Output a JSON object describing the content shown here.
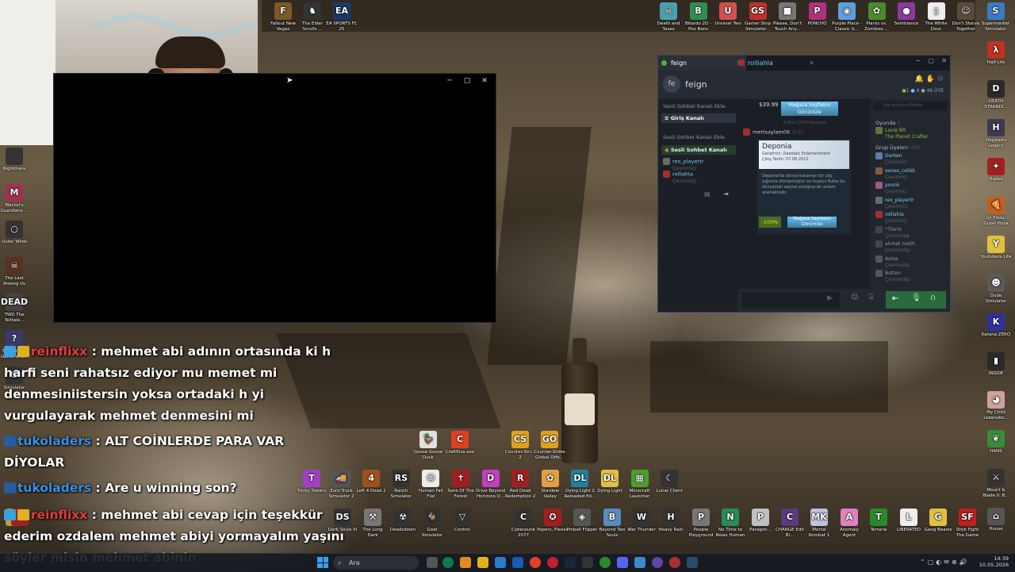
{
  "desktop_top_icons": [
    {
      "label": "Fallout New Vegas",
      "color": "#7a5a2a",
      "glyph": "F"
    },
    {
      "label": "The Elder Scrolls ...",
      "color": "#333",
      "glyph": "♞"
    },
    {
      "label": "EA SPORTS FC 25",
      "color": "#1a3a6a",
      "glyph": "EA"
    }
  ],
  "desktop_top_right": [
    {
      "label": "Death and Taxes",
      "color": "#4aa0b0",
      "glyph": "☠"
    },
    {
      "label": "Bitardo 2D - Poo Bans",
      "color": "#2f8f4f",
      "glyph": "B"
    },
    {
      "label": "Unravel Two",
      "color": "#d05050",
      "glyph": "U"
    },
    {
      "label": "Gamer Stop Simulator...",
      "color": "#c03030",
      "glyph": "GS"
    },
    {
      "label": "Please, Don't Touch Any...",
      "color": "#777",
      "glyph": "■"
    },
    {
      "label": "PONCHO",
      "color": "#b03080",
      "glyph": "P"
    },
    {
      "label": "Purple Place - Classic G...",
      "color": "#5aa0e0",
      "glyph": "◉"
    },
    {
      "label": "Plants vs. Zombies ...",
      "color": "#4a8a2a",
      "glyph": "✿"
    },
    {
      "label": "Semblance",
      "color": "#8a3aa0",
      "glyph": "●"
    },
    {
      "label": "The White Door",
      "color": "#eee",
      "glyph": "▯"
    },
    {
      "label": "Don't Starve Together",
      "color": "#5a4a3a",
      "glyph": "☺"
    },
    {
      "label": "Supermarket Simulator",
      "color": "#3a7ac0",
      "glyph": "S"
    }
  ],
  "desktop_right_column": [
    {
      "label": "Half-Life",
      "color": "#c03020",
      "glyph": "λ"
    },
    {
      "label": "DEATH STRANDI...",
      "color": "#2a2a2a",
      "glyph": "D"
    },
    {
      "label": "Hogwarts Legacy",
      "color": "#3a3a50",
      "glyph": "H"
    },
    {
      "label": "Hades",
      "color": "#a02020",
      "glyph": "✦"
    },
    {
      "label": "İyi Pizza, Güzel Pizza",
      "color": "#c06020",
      "glyph": "🍕"
    },
    {
      "label": "Youtubers Life",
      "color": "#e0c040",
      "glyph": "Y"
    },
    {
      "label": "Dude Simulator",
      "color": "#5a5a5a",
      "glyph": "☻"
    },
    {
      "label": "Katana ZERO",
      "color": "#3030a0",
      "glyph": "K"
    },
    {
      "label": "INSIDE",
      "color": "#2a2a2a",
      "glyph": "▮"
    },
    {
      "label": "My Child Lebensbo...",
      "color": "#d0a0a0",
      "glyph": "◕"
    },
    {
      "label": "HANS",
      "color": "#3a8a3a",
      "glyph": "❦"
    },
    {
      "label": "Mount & Blade II: B...",
      "color": "#333",
      "glyph": "⚔"
    },
    {
      "label": "House",
      "color": "#555",
      "glyph": "⌂"
    }
  ],
  "desktop_left_column": [
    {
      "label": "Nightmare",
      "color": "#333",
      "glyph": ""
    },
    {
      "label": "Marvel's Guardians ...",
      "color": "#a03050",
      "glyph": "M"
    },
    {
      "label": "Outer Wilds",
      "color": "#333",
      "glyph": "○"
    },
    {
      "label": "The Last Among Us",
      "color": "#5a3020",
      "glyph": "☠"
    },
    {
      "label": "TWD The Telltale...",
      "color": "#444",
      "glyph": "DEAD"
    },
    {
      "label": "There Is No Game Wro...",
      "color": "#3a3a6a",
      "glyph": "?"
    },
    {
      "label": "Simulator",
      "color": "#333",
      "glyph": "S"
    }
  ],
  "desktop_mid_icons": [
    {
      "label": "Goose Goose Duck",
      "color": "#e0e0e0",
      "glyph": "🦆"
    },
    {
      "label": "CraftRise.exe",
      "color": "#e04020",
      "glyph": "C"
    },
    {
      "label": "Counter-Stri... 2",
      "color": "#e0a020",
      "glyph": "CS"
    },
    {
      "label": "Counter-Strike Global Offe...",
      "color": "#e0a020",
      "glyph": "GO"
    }
  ],
  "desktop_row1": [
    {
      "label": "Tricky Towers",
      "color": "#a040c0",
      "glyph": "T"
    },
    {
      "label": "Euro Truck Simulator 2",
      "color": "#555",
      "glyph": "🚚"
    },
    {
      "label": "Left 4 Dead 2",
      "color": "#a05020",
      "glyph": "4"
    },
    {
      "label": "Ranch Simulator",
      "color": "#333",
      "glyph": "RS"
    },
    {
      "label": "Human Fall Flat",
      "color": "#eee",
      "glyph": "☺"
    },
    {
      "label": "Sons Of The Forest",
      "color": "#a02020",
      "glyph": "✝"
    },
    {
      "label": "Drive Beyond Horizons D...",
      "color": "#c040c0",
      "glyph": "D"
    },
    {
      "label": "Red Dead Redemption 2",
      "color": "#a02020",
      "glyph": "R"
    },
    {
      "label": "Stardew Valley",
      "color": "#e0a040",
      "glyph": "✿"
    },
    {
      "label": "Dying Light 2 Reloaded Ed...",
      "color": "#2080a0",
      "glyph": "DL"
    },
    {
      "label": "Dying Light",
      "color": "#e0c040",
      "glyph": "DL"
    },
    {
      "label": "Minecraft Launcher",
      "color": "#4aa02a",
      "glyph": "▦"
    },
    {
      "label": "Lunar Client",
      "color": "#333",
      "glyph": "☾"
    }
  ],
  "desktop_row2": [
    {
      "label": "",
      "color": "#c03030",
      "glyph": ""
    },
    {
      "label": "",
      "color": "#c0a030",
      "glyph": ""
    },
    {
      "label": "",
      "color": "#a02020",
      "glyph": ""
    },
    {
      "label": "Dark Souls III",
      "color": "#333",
      "glyph": "DS"
    },
    {
      "label": "The Long Dark",
      "color": "#777",
      "glyph": "⚒"
    },
    {
      "label": "Deadsdown",
      "color": "#333",
      "glyph": "☢"
    },
    {
      "label": "Goat Simulator",
      "color": "#333",
      "glyph": "🐐"
    },
    {
      "label": "Control",
      "color": "#333",
      "glyph": "▽"
    },
    {
      "label": "Cyberpunk 2077",
      "color": "#333",
      "glyph": "C"
    },
    {
      "label": "Papers, Please",
      "color": "#a02020",
      "glyph": "✪"
    },
    {
      "label": "Pinball Flipper",
      "color": "#555",
      "glyph": "◈"
    },
    {
      "label": "Beyond Two Souls",
      "color": "#5a8ac0",
      "glyph": "B"
    },
    {
      "label": "War Thunder",
      "color": "#333",
      "glyph": "W"
    },
    {
      "label": "Heavy Rain",
      "color": "#333",
      "glyph": "H"
    },
    {
      "label": "People Playground",
      "color": "#777",
      "glyph": "P"
    },
    {
      "label": "No Time to Relax Human",
      "color": "#2a8a5a",
      "glyph": "N"
    },
    {
      "label": "Paragon...",
      "color": "#c0c0c0",
      "glyph": "P"
    },
    {
      "label": "CHANGE Edit Bi...",
      "color": "#5a3a80",
      "glyph": "C"
    },
    {
      "label": "Mortal Kombat 1",
      "color": "#c0c0e0",
      "glyph": "MK"
    },
    {
      "label": "Anomaly Agent",
      "color": "#e080c0",
      "glyph": "A"
    },
    {
      "label": "Terraria",
      "color": "#2a8a2a",
      "glyph": "T"
    },
    {
      "label": "LIBERATED",
      "color": "#eee",
      "glyph": "L"
    },
    {
      "label": "Gang Beasts",
      "color": "#e0c040",
      "glyph": "G"
    },
    {
      "label": "Stick Fight The Game",
      "color": "#c02020",
      "glyph": "SF"
    }
  ],
  "black_window": {
    "title": ""
  },
  "steam_chat": {
    "tabs": [
      {
        "label": "feign"
      },
      {
        "label": "rolliahla"
      }
    ],
    "group_avatar": "fe",
    "group_name": "feign",
    "header_stats": {
      "online": "1",
      "members_online": "6",
      "members_total": "46 ÜYE"
    },
    "add_text_channel": "Yazılı Sohbet Kanalı Ekle",
    "text_channel": "Giriş Kanalı",
    "add_voice_channel": "Sesli Sohbet Kanalı Ekle",
    "voice_channel": "Sesli Sohbet Kanalı",
    "voice_users": [
      {
        "name": "reo_playertr",
        "status": "Çevrimiçi"
      },
      {
        "name": "rolliahla",
        "status": "Çevrimiçi"
      }
    ],
    "msg1_price": "$39.99",
    "store_button": "Mağaza Sayfasını Görüntüle",
    "date_sep": "9 Mart 2024 Pazartesi",
    "msg2_user": "mertsaylam06",
    "msg2_time": "20:20",
    "game_title": "Deponia",
    "game_dev": "Geliştirici: Daedalic Entertainment",
    "game_release": "Çıkış Tarihi: 07.08.2012",
    "game_desc": "Deponia'da dünya kocaman bir çöp yığınına dönüşmüştür ve huysuz Rufus bu dünyadaki saçma varlığına bir anlam aramaktadır.",
    "discount": "-100%",
    "search_placeholder": "Kişi ekle/ara Filtrele",
    "in_game_header": "Oyunda",
    "in_game_count": "1",
    "in_game_user": {
      "name": "Lavie BR",
      "game": "The Planet Crafter"
    },
    "group_members_header": "Grup Üyeleri",
    "group_members_count": "(45)",
    "members": [
      {
        "name": "Darken",
        "status": "Çevrimiçi",
        "color": "#5a7ab0"
      },
      {
        "name": "eenes_celikk",
        "status": "Çevrimiçi",
        "color": "#8a5a3a"
      },
      {
        "name": "poonk",
        "status": "Çevrimiçi",
        "color": "#a05a8a"
      },
      {
        "name": "reo_playertr",
        "status": "Çevrimiçi",
        "color": "#6a6a6a"
      },
      {
        "name": "rolliahla",
        "status": "Çevrimiçi",
        "color": "#a03030"
      },
      {
        "name": "ᵐTᴏᴋᴛᴇ",
        "status": "Çevrimdışı",
        "color": "#444"
      },
      {
        "name": "ahmet melih",
        "status": "Çevrimdışı",
        "color": "#444"
      },
      {
        "name": "Avina",
        "status": "Çevrimdışı",
        "color": "#555"
      },
      {
        "name": "Button",
        "status": "Çevrimdışı",
        "color": "#555"
      }
    ]
  },
  "twitch_chat": [
    {
      "line1_prefix": "",
      "user": "reinflixx",
      "msg": ": mehmet abi adının ortasında ki h"
    },
    {
      "text": "harfi seni rahatsız ediyor mu memet mi"
    },
    {
      "text": "denmesiniistersin yoksa ortadaki h yi"
    },
    {
      "text": "vurgulayarak mehmet denmesini mi"
    },
    {
      "user": "tukoladers",
      "msg": ": ALT COİNLERDE PARA VAR"
    },
    {
      "text": "DİYOLAR"
    },
    {
      "user": "tukoladers",
      "msg": ": Are u winning son?"
    },
    {
      "user": "reinflixx",
      "msg": ": mehmet abi cevap için teşekkür"
    },
    {
      "text": "ederim ozdalem mehmet abiyi yormayalım yaşını"
    },
    {
      "text": "söyler misin mehmet abinin"
    }
  ],
  "taskbar": {
    "search_label": "Ara",
    "time": "14:39",
    "date": "10.05.2026"
  }
}
